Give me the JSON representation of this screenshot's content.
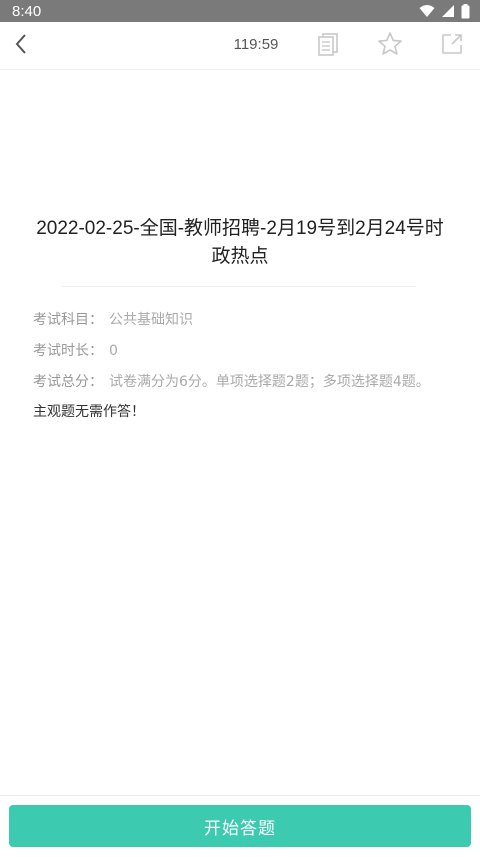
{
  "status_bar": {
    "time": "8:40"
  },
  "header": {
    "timer": "119:59"
  },
  "paper": {
    "title": "2022-02-25-全国-教师招聘-2月19号到2月24号时政热点",
    "info": [
      {
        "label": "考试科目：",
        "value": "公共基础知识"
      },
      {
        "label": "考试时长：",
        "value": "0"
      },
      {
        "label": "考试总分：",
        "value": "试卷满分为6分。单项选择题2题；多项选择题4题。"
      }
    ],
    "note": "主观题无需作答！"
  },
  "footer": {
    "start_label": "开始答题"
  },
  "colors": {
    "accent": "#3ccbb1",
    "status_bar": "#7a7a7a",
    "muted_text": "#999999"
  },
  "icons": [
    "wifi-icon",
    "signal-icon",
    "battery-icon",
    "back-arrow-icon",
    "answer-card-icon",
    "star-icon",
    "share-icon"
  ]
}
